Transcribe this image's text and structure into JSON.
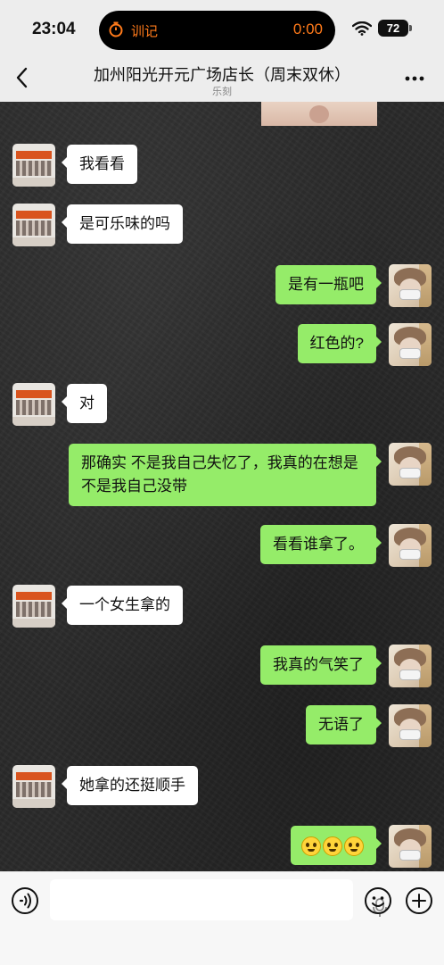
{
  "status_bar": {
    "time": "23:04",
    "island_label": "训记",
    "island_timer": "0:00",
    "battery": "72"
  },
  "nav": {
    "title": "加州阳光开元广场店长（周末双休）",
    "subtitle": "乐刻"
  },
  "messages": [
    {
      "side": "left",
      "text": "我看看"
    },
    {
      "side": "left",
      "text": "是可乐味的吗"
    },
    {
      "side": "right",
      "text": "是有一瓶吧"
    },
    {
      "side": "right",
      "text": "红色的?"
    },
    {
      "side": "left",
      "text": "对"
    },
    {
      "side": "right",
      "text": "那确实 不是我自己失忆了，我真的在想是不是我自己没带"
    },
    {
      "side": "right",
      "text": "看看谁拿了。"
    },
    {
      "side": "left",
      "text": "一个女生拿的"
    },
    {
      "side": "right",
      "text": "我真的气笑了"
    },
    {
      "side": "right",
      "text": "无语了"
    },
    {
      "side": "left",
      "text": "她拿的还挺顺手"
    },
    {
      "side": "right",
      "emoji": [
        "smiling-face-icon",
        "smiling-face-icon",
        "smiling-face-icon"
      ]
    }
  ],
  "colors": {
    "bubble_self": "#95ec69",
    "bubble_other": "#ffffff",
    "island_accent": "#ff7a1a"
  }
}
